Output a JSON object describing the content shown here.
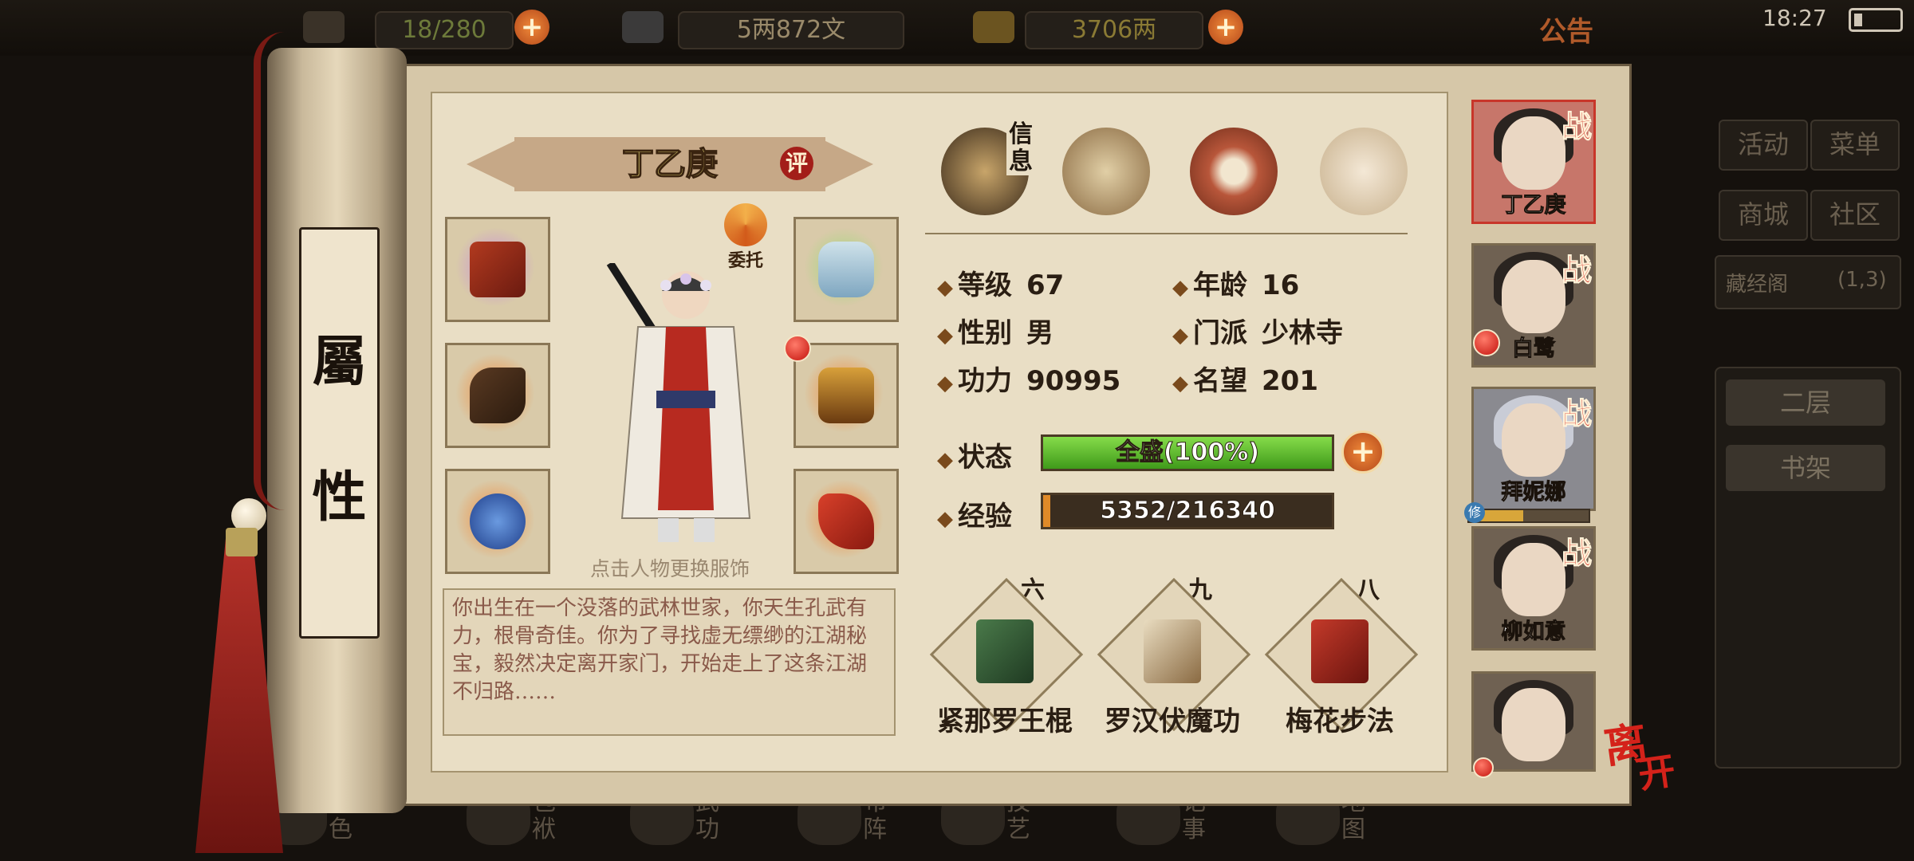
{
  "hud": {
    "stock_value": "18/280",
    "silver": "5两872文",
    "gold": "3706两",
    "notice": "公告",
    "time": "18:27"
  },
  "right_menu": {
    "buttons": [
      "活动",
      "菜单",
      "商城",
      "社区"
    ],
    "library_label": "藏经阁",
    "library_coords": "(1,3)",
    "floor_buttons": [
      "二层",
      "书架"
    ]
  },
  "bottom_nav": [
    "角色",
    "包袱",
    "武功",
    "布阵",
    "技艺",
    "记事",
    "地图"
  ],
  "scroll_title": [
    "屬",
    "性"
  ],
  "character": {
    "name": "丁乙庚",
    "eval_label": "评",
    "entrust_label": "委托",
    "figure_hint": "点击人物更换服饰",
    "bio": "你出生在一个没落的武林世家，你天生孔武有力，根骨奇佳。你为了寻找虚无缥缈的江湖秘宝，毅然决定离开家门，开始走上了这条江湖不归路……"
  },
  "tabs": {
    "info_label": "信息",
    "icons": [
      "info-tab-icon",
      "scroll-tab-icon",
      "bagua-tab-icon",
      "meridian-tab-icon"
    ]
  },
  "stats": {
    "level_label": "等级",
    "level": "67",
    "age_label": "年龄",
    "age": "16",
    "gender_label": "性别",
    "gender": "男",
    "sect_label": "门派",
    "sect": "少林寺",
    "power_label": "功力",
    "power": "90995",
    "fame_label": "名望",
    "fame": "201",
    "status_label": "状态",
    "status_text": "全盛(100%)",
    "status_fraction": 1.0,
    "exp_label": "经验",
    "exp_text": "5352/216340",
    "exp_fraction": 0.0247
  },
  "skills": [
    {
      "rank": "六",
      "name": "紧那罗王棍"
    },
    {
      "rank": "九",
      "name": "罗汉伏魔功"
    },
    {
      "rank": "八",
      "name": "梅花步法"
    }
  ],
  "party": [
    {
      "name": "丁乙庚",
      "battle": "战",
      "active": true
    },
    {
      "name": "白鹭",
      "battle": "战",
      "active": false
    },
    {
      "name": "拜妮娜",
      "battle": "战",
      "active": false
    },
    {
      "name": "柳如意",
      "battle": "战",
      "active": false
    },
    {
      "name": "",
      "battle": "",
      "active": false
    }
  ],
  "cultivate_label": "修",
  "cultivate_fraction": 0.45,
  "leave_label": [
    "离",
    "开"
  ],
  "colors": {
    "hp_bar": "#5fbf2a",
    "exp_bar": "#e08a28",
    "accent_red": "#c3120c"
  }
}
